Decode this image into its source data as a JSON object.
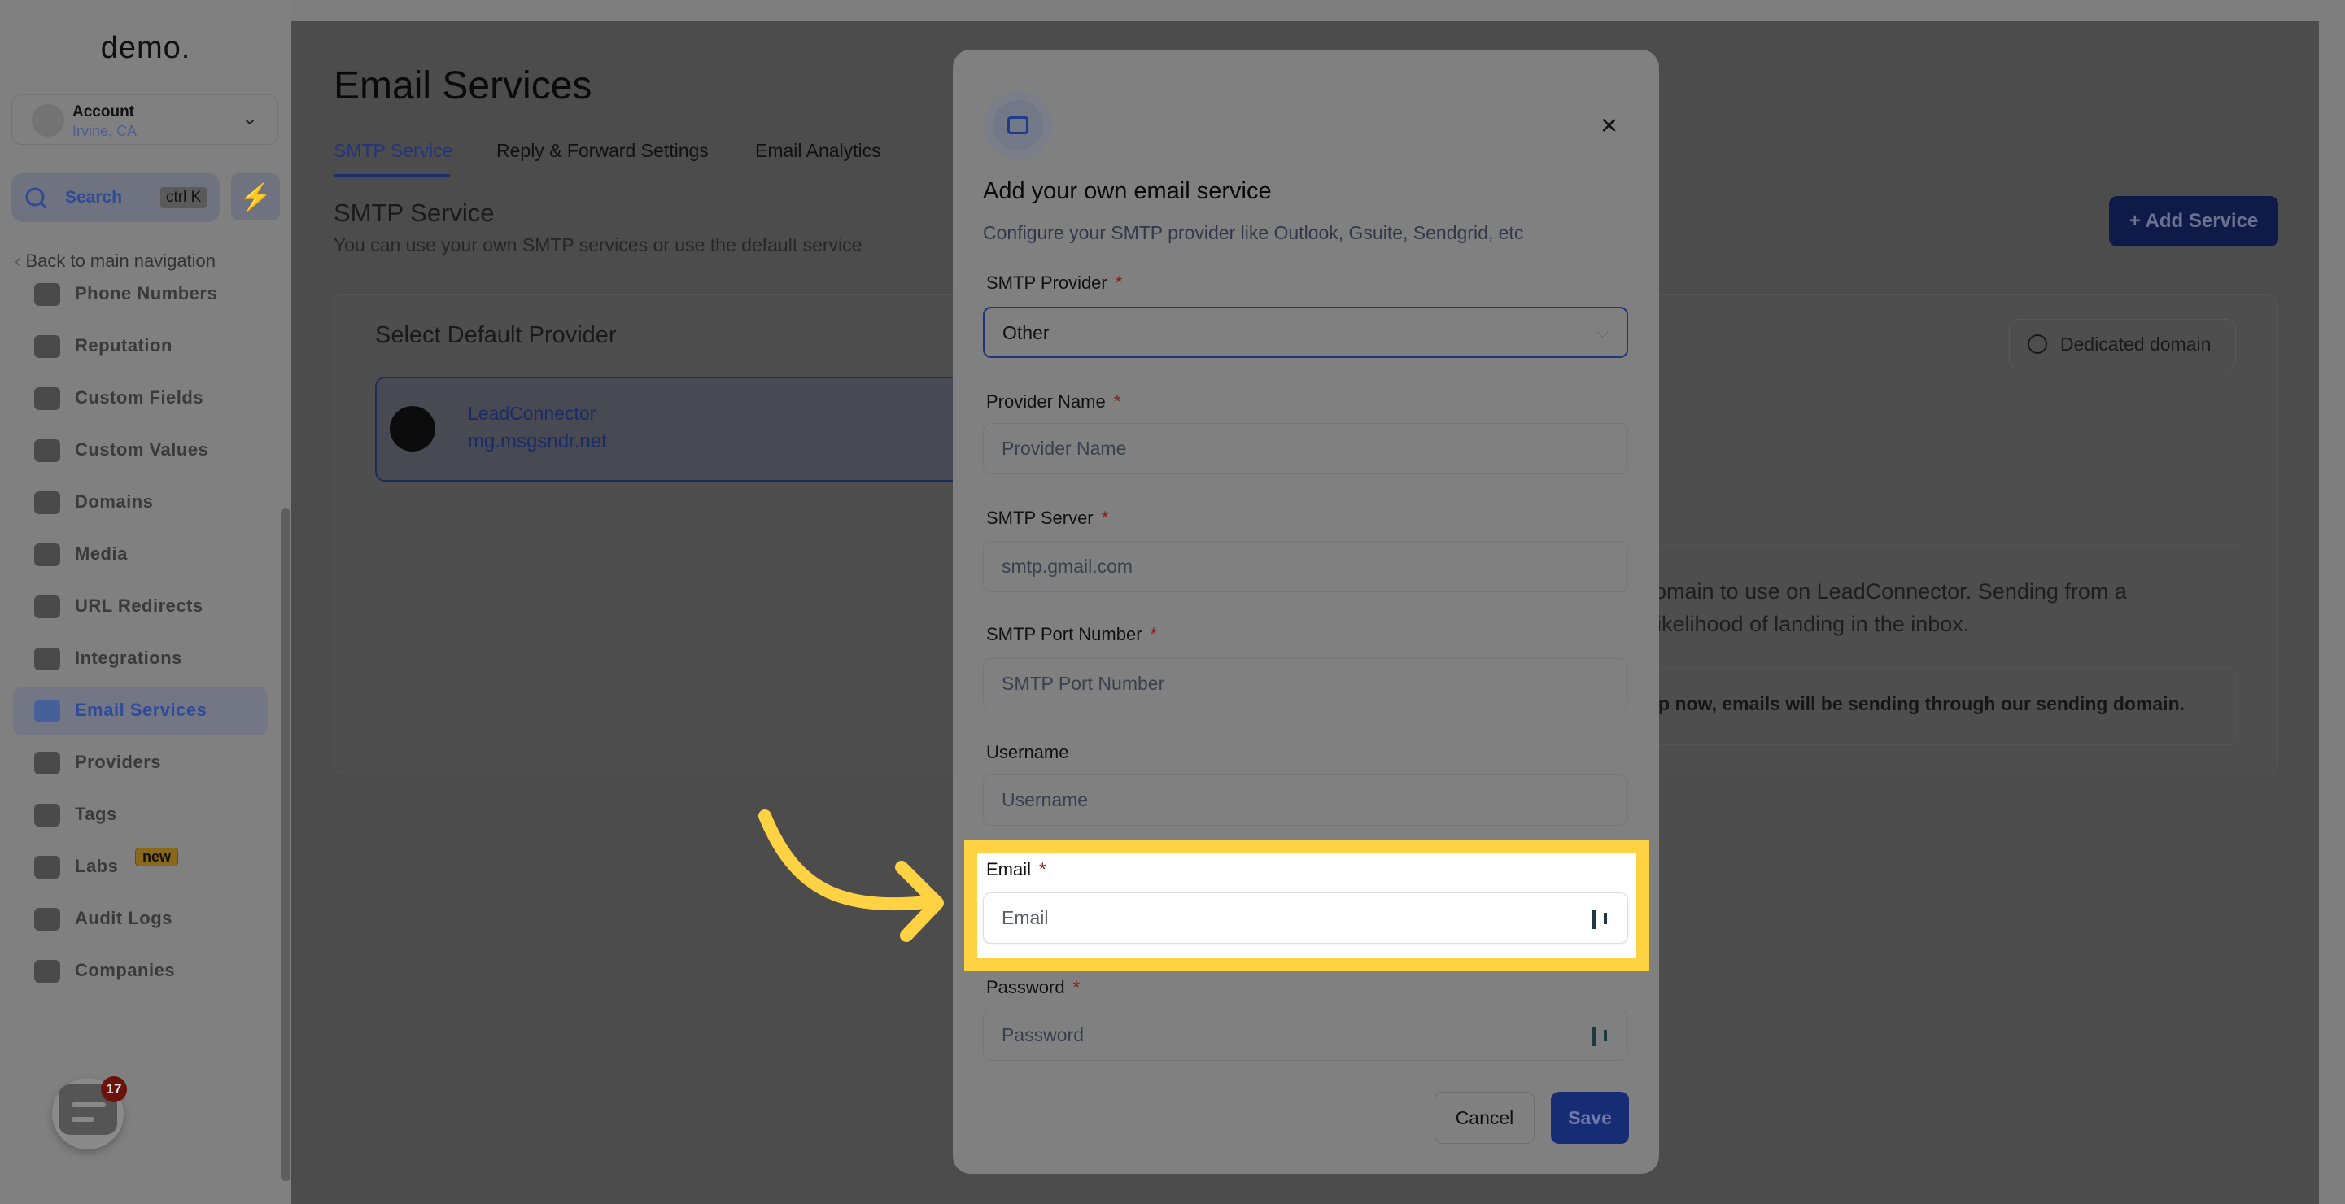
{
  "sidebar": {
    "logo": "demo.",
    "account": {
      "name": "Account",
      "location": "Irvine, CA"
    },
    "search": {
      "label": "Search",
      "shortcut": "ctrl K"
    },
    "back_label": "Back to main navigation",
    "items": [
      {
        "label": "Phone Numbers",
        "icon": "phone-icon"
      },
      {
        "label": "Reputation",
        "icon": "star-icon"
      },
      {
        "label": "Custom Fields",
        "icon": "fields-icon"
      },
      {
        "label": "Custom Values",
        "icon": "diamond-icon"
      },
      {
        "label": "Domains",
        "icon": "globe-icon"
      },
      {
        "label": "Media",
        "icon": "camera-icon"
      },
      {
        "label": "URL Redirects",
        "icon": "redirect-icon"
      },
      {
        "label": "Integrations",
        "icon": "integrations-icon"
      },
      {
        "label": "Email Services",
        "icon": "email-icon",
        "active": true
      },
      {
        "label": "Providers",
        "icon": "clipboard-icon"
      },
      {
        "label": "Tags",
        "icon": "tag-icon"
      },
      {
        "label": "Labs",
        "icon": "flask-icon",
        "badge": "new"
      },
      {
        "label": "Audit Logs",
        "icon": "chart-icon"
      },
      {
        "label": "Companies",
        "icon": "building-icon"
      }
    ],
    "chat_badge": "17"
  },
  "main": {
    "title": "Email Services",
    "tabs": [
      {
        "label": "SMTP Service",
        "active": true
      },
      {
        "label": "Reply & Forward Settings"
      },
      {
        "label": "Email Analytics"
      }
    ],
    "section_title": "SMTP Service",
    "section_subtitle": "You can use your own SMTP services or use the default service",
    "add_service_label": "Add Service",
    "card": {
      "title": "Select Default Provider",
      "provider": {
        "name": "LeadConnector",
        "domain": "mg.msgsndr.net"
      },
      "dedicated_domain_label": "Dedicated domain",
      "text_line1": "domain to use on LeadConnector. Sending from a",
      "text_line2": "likelihood of landing in the inbox.",
      "info_text": "p now, emails will be sending through our sending domain."
    }
  },
  "modal": {
    "title": "Add your own email service",
    "description": "Configure your SMTP provider like Outlook, Gsuite, Sendgrid, etc",
    "fields": {
      "provider": {
        "label": "SMTP Provider",
        "value": "Other",
        "required": "*"
      },
      "provider_name": {
        "label": "Provider Name",
        "placeholder": "Provider Name",
        "required": "*"
      },
      "server": {
        "label": "SMTP Server",
        "placeholder": "smtp.gmail.com",
        "required": "*"
      },
      "port": {
        "label": "SMTP Port Number",
        "placeholder": "SMTP Port Number",
        "required": "*"
      },
      "username": {
        "label": "Username",
        "placeholder": "Username"
      },
      "email": {
        "label": "Email",
        "placeholder": "Email",
        "required": "*"
      },
      "password": {
        "label": "Password",
        "placeholder": "Password",
        "required": "*"
      }
    },
    "cancel_label": "Cancel",
    "save_label": "Save"
  },
  "colors": {
    "highlight": "#ffd243",
    "accent": "#22357a"
  }
}
